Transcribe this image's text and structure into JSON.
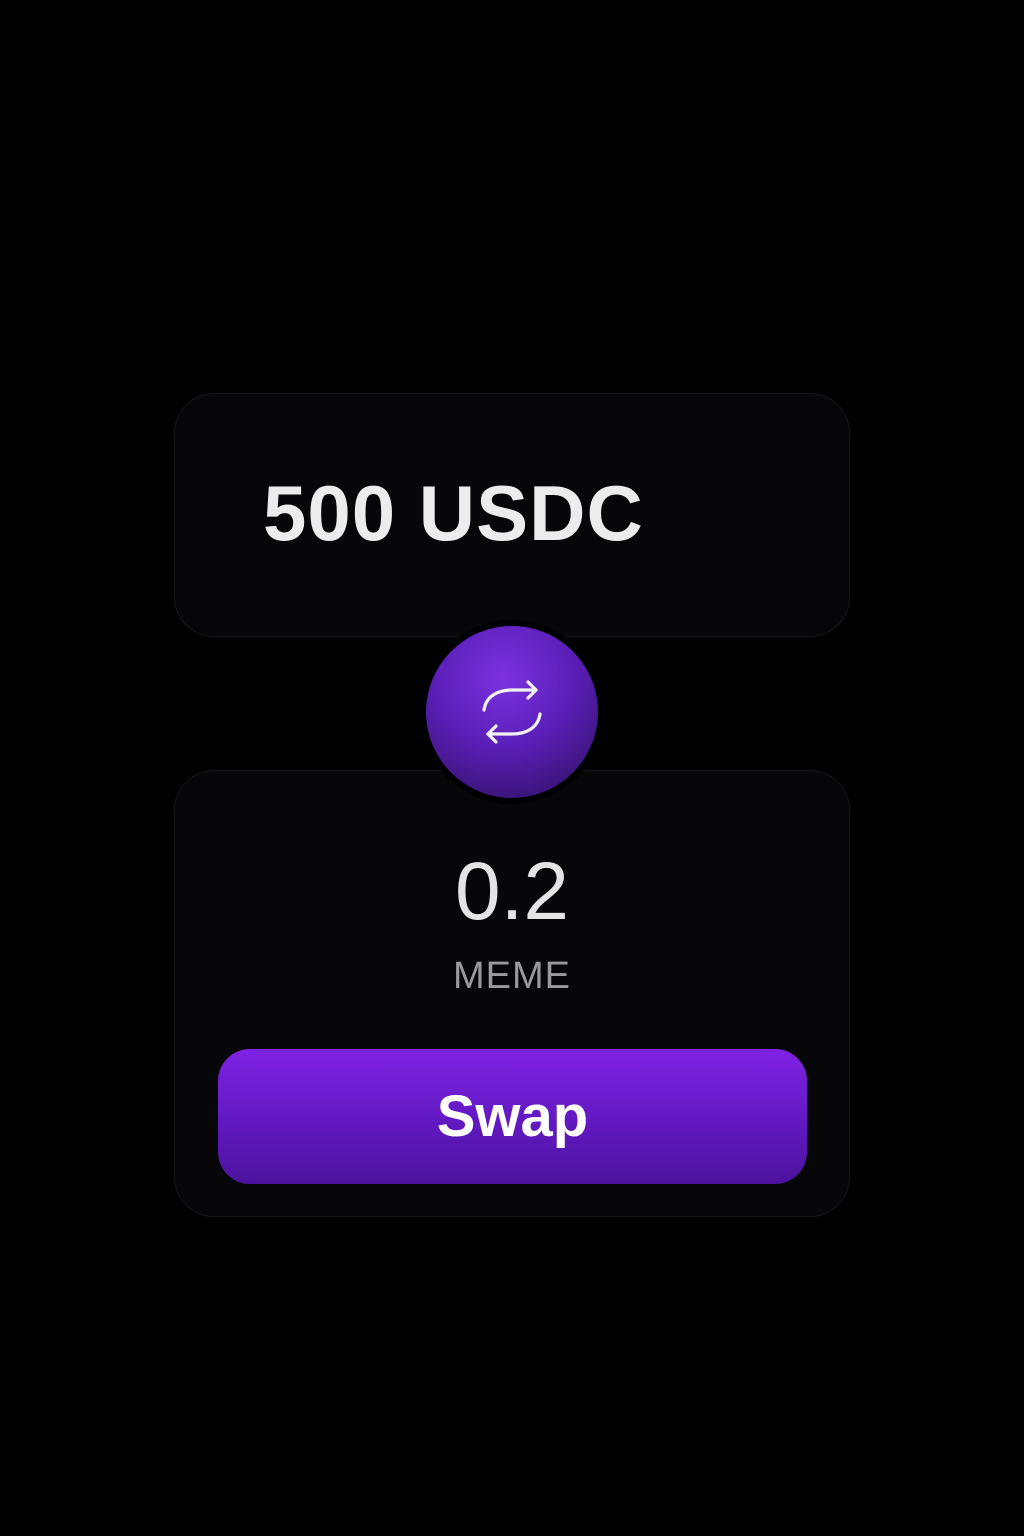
{
  "from": {
    "amount_text": "500 USDC"
  },
  "toggle": {
    "icon": "swap-arrows-icon"
  },
  "to": {
    "amount": "0.2",
    "token": "MEME"
  },
  "actions": {
    "swap_label": "Swap"
  },
  "colors": {
    "background": "#000000",
    "card": "#070709",
    "accent": "#7f22e4",
    "accent_dark": "#4c139e",
    "primary_text": "#ececec",
    "secondary_text": "#9a9a9a"
  }
}
